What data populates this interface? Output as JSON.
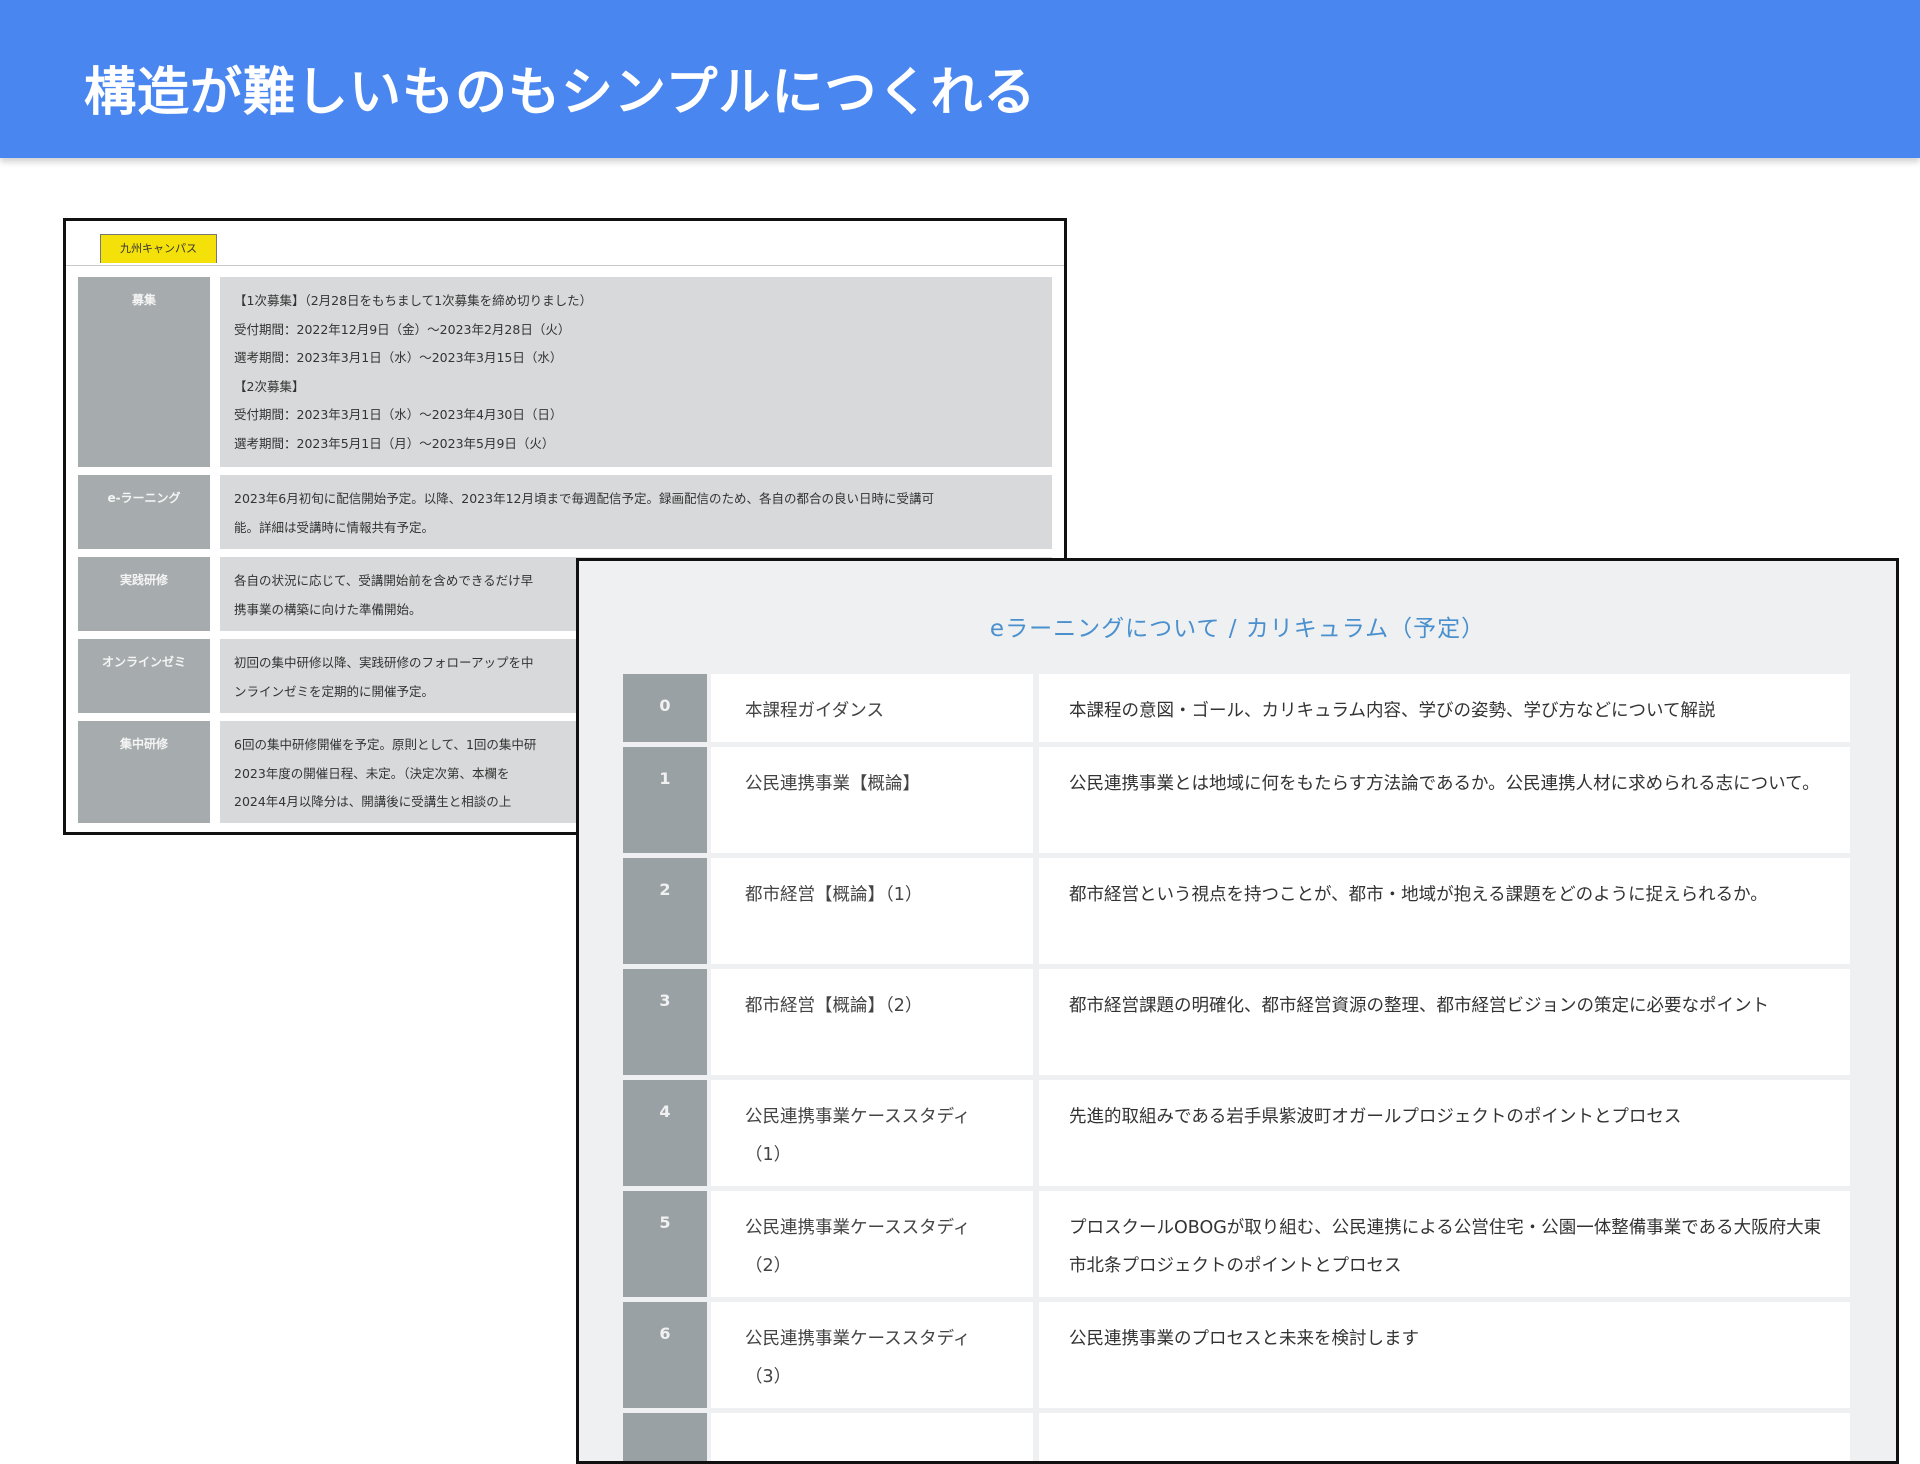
{
  "header": {
    "title": "構造が難しいものもシンプルにつくれる"
  },
  "back_page": {
    "tab_label": "九州キャンパス",
    "rows": [
      {
        "label": "募集",
        "lines": [
          "【1次募集】（2月28日をもちまして1次募集を締め切りました）",
          "受付期間：2022年12月9日（金）〜2023年2月28日（火）",
          "選考期間：2023年3月1日（水）〜2023年3月15日（水）",
          "【2次募集】",
          "受付期間：2023年3月1日（水）〜2023年4月30日（日）",
          "選考期間：2023年5月1日（月）〜2023年5月9日（火）"
        ]
      },
      {
        "label": "e-ラーニング",
        "lines": [
          "2023年6月初旬に配信開始予定。以降、2023年12月頃まで毎週配信予定。録画配信のため、各自の都合の良い日時に受講可",
          "能。詳細は受講時に情報共有予定。"
        ]
      },
      {
        "label": "実践研修",
        "lines": [
          "各自の状況に応じて、受講開始前を含めできるだけ早",
          "携事業の構築に向けた準備開始。"
        ]
      },
      {
        "label": "オンラインゼミ",
        "lines": [
          "初回の集中研修以降、実践研修のフォローアップを中",
          "ンラインゼミを定期的に開催予定。"
        ]
      },
      {
        "label": "集中研修",
        "lines": [
          "6回の集中研修開催を予定。原則として、1回の集中研",
          "2023年度の開催日程、未定。（決定次第、本欄を",
          "2024年4月以降分は、開講後に受講生と相談の上"
        ]
      }
    ]
  },
  "front_page": {
    "heading": "eラーニングについて / カリキュラム（予定）",
    "rows": [
      {
        "num": "0",
        "title": "本課程ガイダンス",
        "desc": "本課程の意図・ゴール、カリキュラム内容、学びの姿勢、学び方などについて解説"
      },
      {
        "num": "1",
        "title": "公民連携事業【概論】",
        "desc": "公民連携事業とは地域に何をもたらす方法論であるか。公民連携人材に求められる志について。"
      },
      {
        "num": "2",
        "title": "都市経営【概論】（1）",
        "desc": "都市経営という視点を持つことが、都市・地域が抱える課題をどのように捉えられるか。"
      },
      {
        "num": "3",
        "title": "都市経営【概論】（2）",
        "desc": "都市経営課題の明確化、都市経営資源の整理、都市経営ビジョンの策定に必要なポイント"
      },
      {
        "num": "4",
        "title": "公民連携事業ケーススタディ（1）",
        "desc": "先進的取組みである岩手県紫波町オガールプロジェクトのポイントとプロセス"
      },
      {
        "num": "5",
        "title": "公民連携事業ケーススタディ（2）",
        "desc": "プロスクールOBOGが取り組む、公民連携による公営住宅・公園一体整備事業である大阪府大東市北条プロジェクトのポイントとプロセス"
      },
      {
        "num": "6",
        "title": "公民連携事業ケーススタディ（3）",
        "desc": "公民連携事業のプロセスと未来を検討します"
      },
      {
        "num": "",
        "title": "",
        "desc": ""
      }
    ]
  }
}
